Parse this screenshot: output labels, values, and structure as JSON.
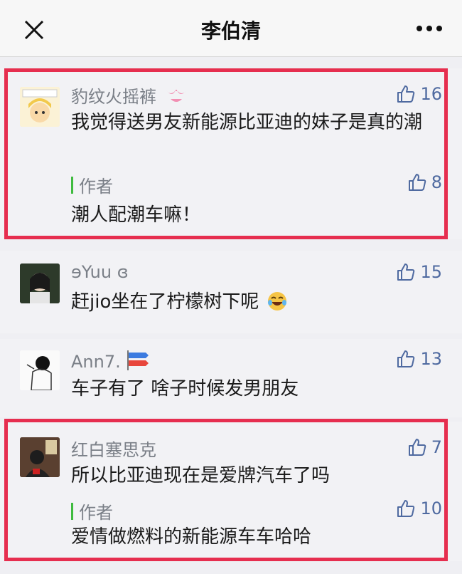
{
  "header": {
    "title": "李伯清"
  },
  "comments": [
    {
      "name": "豹纹火摇裤",
      "likes": "16",
      "text": "我觉得送男友新能源比亚迪的妹子是真的潮",
      "reply": {
        "tag": "作者",
        "likes": "8",
        "text": "潮人配潮车嘛！"
      }
    },
    {
      "name": "ɘYuu ɞ",
      "likes": "15",
      "text": "赶jio坐在了柠檬树下呢"
    },
    {
      "name": "Ann7.",
      "likes": "13",
      "text": "车子有了 啥子时候发男朋友"
    },
    {
      "name": "红白塞思克",
      "likes": "7",
      "text": "所以比亚迪现在是爱牌汽车了吗",
      "reply": {
        "tag": "作者",
        "likes": "10",
        "text": "爱情做燃料的新能源车车哈哈"
      }
    }
  ],
  "icons": {
    "close": "close-icon",
    "more": "more-icon",
    "like": "thumbs-up-icon",
    "laugh": "laughing-emoji-icon"
  },
  "colors": {
    "highlight_border": "#e62e4f",
    "like_blue": "#4f6aa0",
    "author_bar": "#3fbb3f"
  }
}
